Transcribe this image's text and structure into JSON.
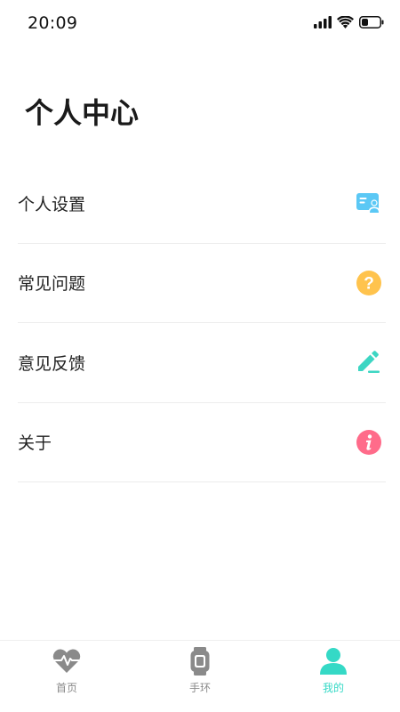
{
  "status_bar": {
    "time": "20:09",
    "icons": [
      "signal-icon",
      "wifi-icon",
      "battery-icon"
    ]
  },
  "page": {
    "title": "个人中心"
  },
  "menu": {
    "items": [
      {
        "label": "个人设置",
        "icon": "profile-card-icon",
        "icon_color": "#5bc8f5"
      },
      {
        "label": "常见问题",
        "icon": "question-icon",
        "icon_color": "#ffc34d"
      },
      {
        "label": "意见反馈",
        "icon": "edit-icon",
        "icon_color": "#3dd6c3"
      },
      {
        "label": "关于",
        "icon": "info-icon",
        "icon_color": "#ff6b8a"
      }
    ]
  },
  "tabbar": {
    "tabs": [
      {
        "label": "首页",
        "icon": "heartbeat-icon",
        "active": false
      },
      {
        "label": "手环",
        "icon": "watch-icon",
        "active": false
      },
      {
        "label": "我的",
        "icon": "user-icon",
        "active": true
      }
    ],
    "active_color": "#35d9c6",
    "inactive_color": "#8a8a8a"
  }
}
